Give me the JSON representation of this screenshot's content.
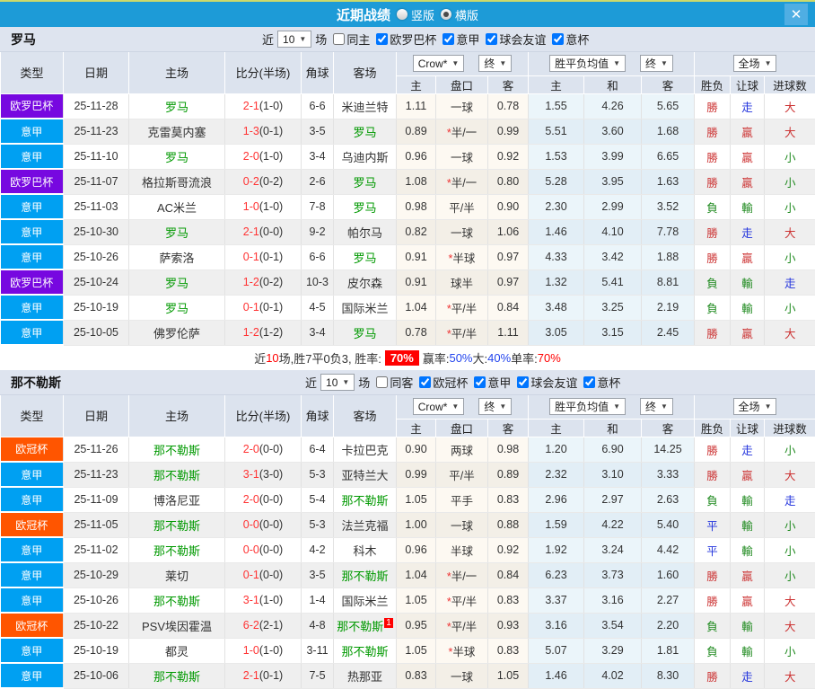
{
  "title_bar": {
    "title": "近期战绩",
    "radio_vertical": "竖版",
    "radio_horizontal": "横版",
    "close": "✕"
  },
  "filter_labels": {
    "near": "近",
    "games": "场"
  },
  "colors": {
    "header_blue": "#1d9bd7",
    "type_europa_purple": "#7708e0",
    "type_serie_a_blue": "#00a0f2",
    "type_ucl_orange": "#ff5500",
    "team_highlight_green": "#009900",
    "win_red": "#cc3333",
    "lose_green": "#1f8a1f",
    "push_blue": "#2233dd"
  },
  "table": {
    "headers": {
      "left": [
        "类型",
        "日期",
        "主场",
        "比分(半场)",
        "角球",
        "客场"
      ],
      "sub": [
        "主",
        "盘口",
        "客",
        "主",
        "和",
        "客",
        "胜负",
        "让球",
        "进球数"
      ],
      "dd": {
        "crow": "Crow*",
        "final1": "终",
        "avg": "胜平负均值",
        "final2": "终",
        "full": "全场"
      }
    }
  },
  "sections": [
    {
      "team": "罗马",
      "filter": {
        "count": "10",
        "same": "同主",
        "leagues": [
          "欧罗巴杯",
          "意甲",
          "球会友谊",
          "意杯"
        ]
      },
      "rows": [
        {
          "ty": "欧罗巴杯",
          "dt": "25-11-28",
          "hm": "罗马",
          "hG": true,
          "sc": "2-1",
          "hf": "(1-0)",
          "cn": "6-6",
          "aw": "米迪兰特",
          "aG": false,
          "h": "1.11",
          "ln": "一球",
          "a": "0.78",
          "w": "1.55",
          "d": "4.26",
          "l": "5.65",
          "rs": "勝",
          "ah": "走",
          "ou": "大"
        },
        {
          "ty": "意甲",
          "dt": "25-11-23",
          "hm": "克雷莫内塞",
          "hG": false,
          "sc": "1-3",
          "hf": "(0-1)",
          "cn": "3-5",
          "aw": "罗马",
          "aG": true,
          "h": "0.89",
          "ln": "*半/一",
          "a": "0.99",
          "w": "5.51",
          "d": "3.60",
          "l": "1.68",
          "rs": "勝",
          "ah": "贏",
          "ou": "大"
        },
        {
          "ty": "意甲",
          "dt": "25-11-10",
          "hm": "罗马",
          "hG": true,
          "sc": "2-0",
          "hf": "(1-0)",
          "cn": "3-4",
          "aw": "乌迪内斯",
          "aG": false,
          "h": "0.96",
          "ln": "一球",
          "a": "0.92",
          "w": "1.53",
          "d": "3.99",
          "l": "6.65",
          "rs": "勝",
          "ah": "贏",
          "ou": "小"
        },
        {
          "ty": "欧罗巴杯",
          "dt": "25-11-07",
          "hm": "格拉斯哥流浪",
          "hG": false,
          "sc": "0-2",
          "hf": "(0-2)",
          "cn": "2-6",
          "aw": "罗马",
          "aG": true,
          "h": "1.08",
          "ln": "*半/一",
          "a": "0.80",
          "w": "5.28",
          "d": "3.95",
          "l": "1.63",
          "rs": "勝",
          "ah": "贏",
          "ou": "小"
        },
        {
          "ty": "意甲",
          "dt": "25-11-03",
          "hm": "AC米兰",
          "hG": false,
          "sc": "1-0",
          "hf": "(1-0)",
          "cn": "7-8",
          "aw": "罗马",
          "aG": true,
          "h": "0.98",
          "ln": "平/半",
          "a": "0.90",
          "w": "2.30",
          "d": "2.99",
          "l": "3.52",
          "rs": "負",
          "ah": "輸",
          "ou": "小"
        },
        {
          "ty": "意甲",
          "dt": "25-10-30",
          "hm": "罗马",
          "hG": true,
          "sc": "2-1",
          "hf": "(0-0)",
          "cn": "9-2",
          "aw": "帕尔马",
          "aG": false,
          "h": "0.82",
          "ln": "一球",
          "a": "1.06",
          "w": "1.46",
          "d": "4.10",
          "l": "7.78",
          "rs": "勝",
          "ah": "走",
          "ou": "大"
        },
        {
          "ty": "意甲",
          "dt": "25-10-26",
          "hm": "萨索洛",
          "hG": false,
          "sc": "0-1",
          "hf": "(0-1)",
          "cn": "6-6",
          "aw": "罗马",
          "aG": true,
          "h": "0.91",
          "ln": "*半球",
          "a": "0.97",
          "w": "4.33",
          "d": "3.42",
          "l": "1.88",
          "rs": "勝",
          "ah": "贏",
          "ou": "小"
        },
        {
          "ty": "欧罗巴杯",
          "dt": "25-10-24",
          "hm": "罗马",
          "hG": true,
          "sc": "1-2",
          "hf": "(0-2)",
          "cn": "10-3",
          "aw": "皮尔森",
          "aG": false,
          "h": "0.91",
          "ln": "球半",
          "a": "0.97",
          "w": "1.32",
          "d": "5.41",
          "l": "8.81",
          "rs": "負",
          "ah": "輸",
          "ou": "走"
        },
        {
          "ty": "意甲",
          "dt": "25-10-19",
          "hm": "罗马",
          "hG": true,
          "sc": "0-1",
          "hf": "(0-1)",
          "cn": "4-5",
          "aw": "国际米兰",
          "aG": false,
          "h": "1.04",
          "ln": "*平/半",
          "a": "0.84",
          "w": "3.48",
          "d": "3.25",
          "l": "2.19",
          "rs": "負",
          "ah": "輸",
          "ou": "小"
        },
        {
          "ty": "意甲",
          "dt": "25-10-05",
          "hm": "佛罗伦萨",
          "hG": false,
          "sc": "1-2",
          "hf": "(1-2)",
          "cn": "3-4",
          "aw": "罗马",
          "aG": true,
          "h": "0.78",
          "ln": "*平/半",
          "a": "1.11",
          "w": "3.05",
          "d": "3.15",
          "l": "2.45",
          "rs": "勝",
          "ah": "贏",
          "ou": "大"
        }
      ],
      "summary": [
        {
          "t": "近"
        },
        {
          "t": "10",
          "c": "red"
        },
        {
          "t": "场,胜7平0负3, 胜率:"
        },
        {
          "t": "70%",
          "c": "badge"
        },
        {
          "t": "赢率:"
        },
        {
          "t": "50%",
          "c": "blu"
        },
        {
          "t": " 大:"
        },
        {
          "t": "40%",
          "c": "blu"
        },
        {
          "t": " 单率:"
        },
        {
          "t": "70%",
          "c": "red"
        }
      ]
    },
    {
      "team": "那不勒斯",
      "filter": {
        "count": "10",
        "same": "同客",
        "leagues": [
          "欧冠杯",
          "意甲",
          "球会友谊",
          "意杯"
        ]
      },
      "rows": [
        {
          "ty": "欧冠杯",
          "dt": "25-11-26",
          "hm": "那不勒斯",
          "hG": true,
          "sc": "2-0",
          "hf": "(0-0)",
          "cn": "6-4",
          "aw": "卡拉巴克",
          "aG": false,
          "h": "0.90",
          "ln": "两球",
          "a": "0.98",
          "w": "1.20",
          "d": "6.90",
          "l": "14.25",
          "rs": "勝",
          "ah": "走",
          "ou": "小"
        },
        {
          "ty": "意甲",
          "dt": "25-11-23",
          "hm": "那不勒斯",
          "hG": true,
          "sc": "3-1",
          "hf": "(3-0)",
          "cn": "5-3",
          "aw": "亚特兰大",
          "aG": false,
          "h": "0.99",
          "ln": "平/半",
          "a": "0.89",
          "w": "2.32",
          "d": "3.10",
          "l": "3.33",
          "rs": "勝",
          "ah": "贏",
          "ou": "大"
        },
        {
          "ty": "意甲",
          "dt": "25-11-09",
          "hm": "博洛尼亚",
          "hG": false,
          "sc": "2-0",
          "hf": "(0-0)",
          "cn": "5-4",
          "aw": "那不勒斯",
          "aG": true,
          "h": "1.05",
          "ln": "平手",
          "a": "0.83",
          "w": "2.96",
          "d": "2.97",
          "l": "2.63",
          "rs": "負",
          "ah": "輸",
          "ou": "走"
        },
        {
          "ty": "欧冠杯",
          "dt": "25-11-05",
          "hm": "那不勒斯",
          "hG": true,
          "sc": "0-0",
          "hf": "(0-0)",
          "cn": "5-3",
          "aw": "法兰克福",
          "aG": false,
          "h": "1.00",
          "ln": "一球",
          "a": "0.88",
          "w": "1.59",
          "d": "4.22",
          "l": "5.40",
          "rs": "平",
          "ah": "輸",
          "ou": "小"
        },
        {
          "ty": "意甲",
          "dt": "25-11-02",
          "hm": "那不勒斯",
          "hG": true,
          "sc": "0-0",
          "hf": "(0-0)",
          "cn": "4-2",
          "aw": "科木",
          "aG": false,
          "h": "0.96",
          "ln": "半球",
          "a": "0.92",
          "w": "1.92",
          "d": "3.24",
          "l": "4.42",
          "rs": "平",
          "ah": "輸",
          "ou": "小"
        },
        {
          "ty": "意甲",
          "dt": "25-10-29",
          "hm": "莱切",
          "hG": false,
          "sc": "0-1",
          "hf": "(0-0)",
          "cn": "3-5",
          "aw": "那不勒斯",
          "aG": true,
          "h": "1.04",
          "ln": "*半/一",
          "a": "0.84",
          "w": "6.23",
          "d": "3.73",
          "l": "1.60",
          "rs": "勝",
          "ah": "贏",
          "ou": "小"
        },
        {
          "ty": "意甲",
          "dt": "25-10-26",
          "hm": "那不勒斯",
          "hG": true,
          "sc": "3-1",
          "hf": "(1-0)",
          "cn": "1-4",
          "aw": "国际米兰",
          "aG": false,
          "h": "1.05",
          "ln": "*平/半",
          "a": "0.83",
          "w": "3.37",
          "d": "3.16",
          "l": "2.27",
          "rs": "勝",
          "ah": "贏",
          "ou": "大"
        },
        {
          "ty": "欧冠杯",
          "dt": "25-10-22",
          "hm": "PSV埃因霍温",
          "hG": false,
          "sc": "6-2",
          "hf": "(2-1)",
          "cn": "4-8",
          "aw": "那不勒斯",
          "aG": true,
          "ab": "1",
          "h": "0.95",
          "ln": "*平/半",
          "a": "0.93",
          "w": "3.16",
          "d": "3.54",
          "l": "2.20",
          "rs": "負",
          "ah": "輸",
          "ou": "大"
        },
        {
          "ty": "意甲",
          "dt": "25-10-19",
          "hm": "都灵",
          "hG": false,
          "sc": "1-0",
          "hf": "(1-0)",
          "cn": "3-11",
          "aw": "那不勒斯",
          "aG": true,
          "h": "1.05",
          "ln": "*半球",
          "a": "0.83",
          "w": "5.07",
          "d": "3.29",
          "l": "1.81",
          "rs": "負",
          "ah": "輸",
          "ou": "小"
        },
        {
          "ty": "意甲",
          "dt": "25-10-06",
          "hm": "那不勒斯",
          "hG": true,
          "sc": "2-1",
          "hf": "(0-1)",
          "cn": "7-5",
          "aw": "热那亚",
          "aG": false,
          "h": "0.83",
          "ln": "一球",
          "a": "1.05",
          "w": "1.46",
          "d": "4.02",
          "l": "8.30",
          "rs": "勝",
          "ah": "走",
          "ou": "大"
        }
      ]
    }
  ]
}
